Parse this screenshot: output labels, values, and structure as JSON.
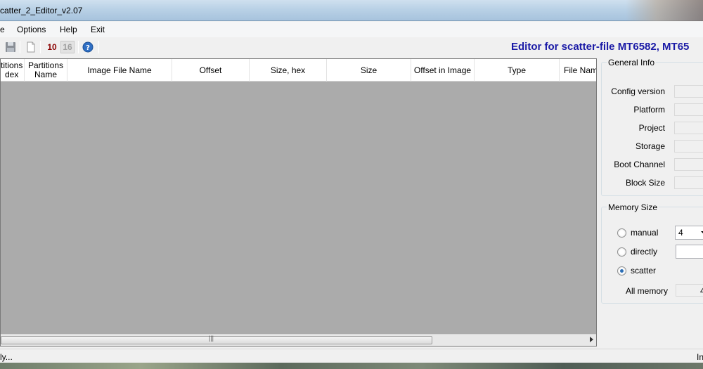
{
  "window": {
    "title": "catter_2_Editor_v2.07"
  },
  "menu": [
    "e",
    "Options",
    "Help",
    "Exit"
  ],
  "toolbar": {
    "editor_title": "Editor for scatter-file MT6582, MT65",
    "dec_label": "10",
    "hex_label": "16",
    "icons": [
      "save-icon",
      "new-file-icon",
      "decimal-mode-icon",
      "hex-mode-icon",
      "help-icon"
    ]
  },
  "table": {
    "columns": [
      {
        "line1": "titions",
        "line2": "dex"
      },
      {
        "line1": "Partitions",
        "line2": "Name"
      },
      {
        "line1": "Image File Name",
        "line2": ""
      },
      {
        "line1": "Offset",
        "line2": ""
      },
      {
        "line1": "Size, hex",
        "line2": ""
      },
      {
        "line1": "Size",
        "line2": ""
      },
      {
        "line1": "Offset in Image",
        "line2": ""
      },
      {
        "line1": "Type",
        "line2": ""
      },
      {
        "line1": "File Name",
        "line2": ""
      }
    ],
    "scroll_grip": "|||"
  },
  "general_info": {
    "title": "General Info",
    "fields": [
      "Config version",
      "Platform",
      "Project",
      "Storage",
      "Boot Channel",
      "Block Size"
    ]
  },
  "memory_size": {
    "title": "Memory Size",
    "options": [
      {
        "label": "manual",
        "checked": false
      },
      {
        "label": "directly",
        "checked": false
      },
      {
        "label": "scatter",
        "checked": true
      }
    ],
    "manual_value": "4",
    "all_memory_label": "All memory",
    "all_memory_value": "4"
  },
  "status": {
    "left": "ly...",
    "right": "In"
  }
}
